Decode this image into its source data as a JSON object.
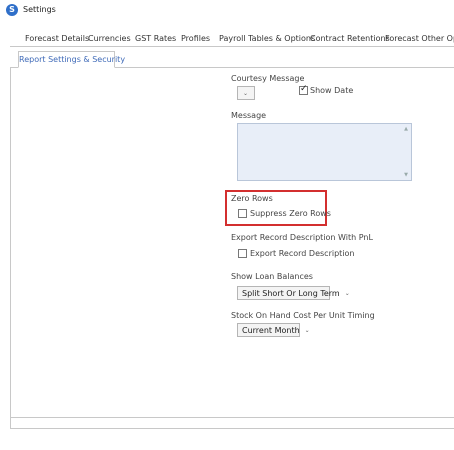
{
  "window": {
    "title": "Settings",
    "icon": "settings-app-icon"
  },
  "tabs": [
    {
      "label": "Forecast Details"
    },
    {
      "label": "Currencies"
    },
    {
      "label": "GST Rates"
    },
    {
      "label": "Profiles"
    },
    {
      "label": "Payroll Tables & Options"
    },
    {
      "label": "Contract Retentions"
    },
    {
      "label": "Forecast Other Opti"
    }
  ],
  "subtab": {
    "label": "Report Settings & Security"
  },
  "courtesy": {
    "label": "Courtesy Message",
    "value": ""
  },
  "show_date": {
    "label": "Show Date",
    "checked": true
  },
  "message": {
    "label": "Message",
    "value": ""
  },
  "zero_rows": {
    "label": "Zero Rows",
    "checkbox_label": "Suppress Zero Rows",
    "checked": false
  },
  "export_desc": {
    "label": "Export Record Description With PnL",
    "checkbox_label": "Export Record Description",
    "checked": false
  },
  "loan": {
    "label": "Show Loan Balances",
    "value": "Split Short Or Long Term"
  },
  "stock": {
    "label": "Stock On Hand Cost Per Unit Timing",
    "value": "Current Month"
  },
  "colors": {
    "accent": "#3f6ab8",
    "highlight": "#d32f2f",
    "textarea_bg": "#e8eef8"
  }
}
